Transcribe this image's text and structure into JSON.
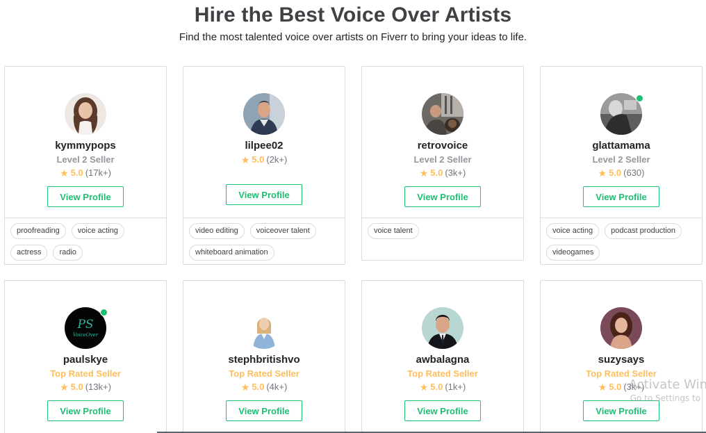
{
  "header": {
    "title": "Hire the Best Voice Over Artists",
    "subtitle": "Find the most talented voice over artists on Fiverr to bring your ideas to life."
  },
  "cards": [
    {
      "username": "kymmypops",
      "level": "Level 2 Seller",
      "rating": "5.0",
      "reviews": "(17k+)",
      "button": "View Profile",
      "online": false,
      "tags": [
        "proofreading",
        "voice acting",
        "actress",
        "radio"
      ]
    },
    {
      "username": "lilpee02",
      "level": "",
      "rating": "5.0",
      "reviews": "(2k+)",
      "button": "View Profile",
      "online": false,
      "tags": [
        "video editing",
        "voiceover talent",
        "whiteboard animation"
      ]
    },
    {
      "username": "retrovoice",
      "level": "Level 2 Seller",
      "rating": "5.0",
      "reviews": "(3k+)",
      "button": "View Profile",
      "online": false,
      "tags": [
        "voice talent"
      ]
    },
    {
      "username": "glattamama",
      "level": "Level 2 Seller",
      "rating": "5.0",
      "reviews": "(630)",
      "button": "View Profile",
      "online": true,
      "tags": [
        "voice acting",
        "podcast production",
        "videogames"
      ]
    },
    {
      "username": "paulskye",
      "level": "Top Rated Seller",
      "rating": "5.0",
      "reviews": "(13k+)",
      "button": "View Profile",
      "online": true,
      "tags": []
    },
    {
      "username": "stephbritishvo",
      "level": "Top Rated Seller",
      "rating": "5.0",
      "reviews": "(4k+)",
      "button": "View Profile",
      "online": false,
      "tags": []
    },
    {
      "username": "awbalagna",
      "level": "Top Rated Seller",
      "rating": "5.0",
      "reviews": "(1k+)",
      "button": "View Profile",
      "online": false,
      "tags": []
    },
    {
      "username": "suzysays",
      "level": "Top Rated Seller",
      "rating": "5.0",
      "reviews": "(3k+)",
      "button": "View Profile",
      "online": false,
      "tags": []
    }
  ],
  "watermark": {
    "line1": "Activate Win",
    "line2": "Go to Settings to"
  },
  "colors": {
    "accent": "#1dbf73",
    "star": "#ffbe5b",
    "top_rated": "#ffbe5b",
    "level_text": "#95979d",
    "border": "#dadbdd"
  }
}
